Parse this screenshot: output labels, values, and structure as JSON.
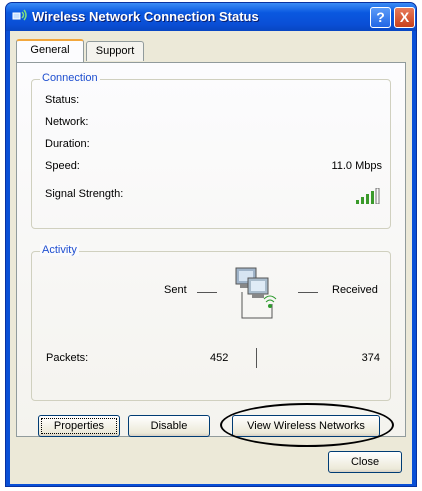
{
  "window": {
    "title": "Wireless Network Connection Status",
    "help_label": "?",
    "close_label": "X"
  },
  "tabs": [
    {
      "label": "General",
      "selected": true
    },
    {
      "label": "Support",
      "selected": false
    }
  ],
  "connection": {
    "group_label": "Connection",
    "status_label": "Status:",
    "status_value": "",
    "network_label": "Network:",
    "network_value": "",
    "duration_label": "Duration:",
    "duration_value": "",
    "speed_label": "Speed:",
    "speed_value": "11.0 Mbps",
    "signal_label": "Signal Strength:",
    "signal_bars_filled": 4,
    "signal_bars_total": 5
  },
  "activity": {
    "group_label": "Activity",
    "sent_label": "Sent",
    "received_label": "Received",
    "packets_label": "Packets:",
    "packets_sent": "452",
    "packets_received": "374"
  },
  "buttons": {
    "properties": "Properties",
    "disable": "Disable",
    "view_networks": "View Wireless Networks",
    "close": "Close"
  },
  "colors": {
    "titlebar": "#0a4fd6",
    "group_label": "#1f4fd0",
    "dialog_bg": "#ece9d8"
  }
}
